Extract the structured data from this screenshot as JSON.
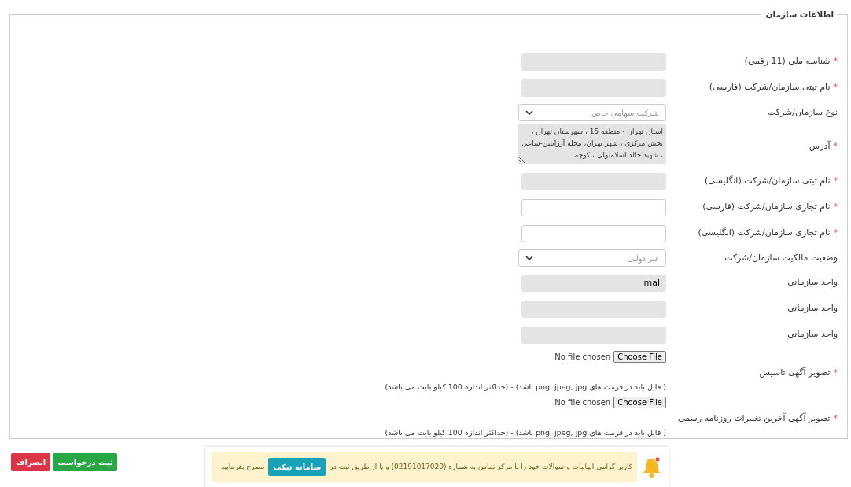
{
  "section": {
    "legend": "اطلاعات سازمان"
  },
  "required_mark": "*",
  "fields": [
    {
      "kind": "text",
      "label": "شناسه ملی (11 رقمی)",
      "required": true,
      "readonly": true
    },
    {
      "kind": "text",
      "label": "نام ثبتی سازمان/شرکت (فارسی)",
      "required": true,
      "readonly": true
    },
    {
      "kind": "select",
      "label": "نوع سازمان/شرکت",
      "required": false,
      "value": "شرکت سهامي خاص"
    },
    {
      "kind": "textarea",
      "label": "آدرس",
      "required": true,
      "readonly": true,
      "value": "استان تهران - منطقه 15 ، شهرستان تهران ، بخش مرکزي ، شهر تهران، محله آرژانتين-ساعي ، شهيد خالد اسلامبولي ، کوچه"
    },
    {
      "kind": "text",
      "label": "نام ثبتی سازمان/شرکت (انگلیسی)",
      "required": true,
      "readonly": true
    },
    {
      "kind": "text",
      "label": "نام تجاری سازمان/شرکت (فارسی)",
      "required": true,
      "readonly": false
    },
    {
      "kind": "text",
      "label": "نام تجاری سازمان/شرکت (انگلیسی)",
      "required": true,
      "readonly": false
    },
    {
      "kind": "select",
      "label": "وضعیت مالکیت سازمان/شرکت",
      "required": false,
      "value": "غیر دولتی"
    },
    {
      "kind": "text",
      "label": "واحد سازمانی",
      "required": false,
      "readonly": true,
      "value": "mali"
    },
    {
      "kind": "text",
      "label": "واحد سازمانی",
      "required": false,
      "readonly": true
    },
    {
      "kind": "text",
      "label": "واحد سازمانی",
      "required": false,
      "readonly": true
    },
    {
      "kind": "file",
      "label": "تصویر آگهی تاسیس",
      "required": true,
      "button": "Choose File",
      "status": "No file chosen",
      "hint": "( فایل باید در فرمت های png, jpeg, jpg باشد) - (حداکثر اندازه 100 کیلو بایت می باشد)"
    },
    {
      "kind": "file",
      "label": "تصویر آگهی آخرین تغییرات روزنامه رسمی",
      "required": true,
      "button": "Choose File",
      "status": "No file chosen",
      "hint": "( فایل باید در فرمت های png, jpeg, jpg باشد) - (حداکثر اندازه 100 کیلو بایت می باشد)"
    }
  ],
  "notice": {
    "text_before": "کاربر گرامی ابهامات و سوالات خود را با مرکز تماس به شماره (02191017020) و یا از طریق ثبت در",
    "link": "سامانه تیکت",
    "text_after": "مطرح بفرمایید",
    "unread": true
  },
  "buttons": [
    {
      "kind": "submit",
      "label": "ثبت درخواست"
    },
    {
      "kind": "cancel",
      "label": "انصراف"
    }
  ]
}
